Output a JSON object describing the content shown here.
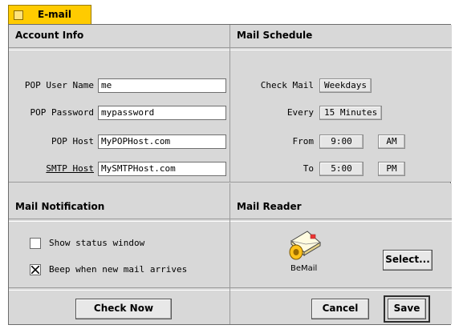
{
  "tab": {
    "title": "E-mail"
  },
  "account_info": {
    "title": "Account Info",
    "fields": [
      {
        "label": "POP User Name",
        "value": "me"
      },
      {
        "label": "POP Password",
        "value": "mypassword"
      },
      {
        "label": "POP Host",
        "value": "MyPOPHost.com"
      },
      {
        "label": "SMTP Host",
        "value": "MySMTPHost.com"
      }
    ]
  },
  "mail_schedule": {
    "title": "Mail Schedule",
    "check_mail_label": "Check Mail",
    "check_mail_value": "Weekdays",
    "every_label": "Every",
    "every_value": "15 Minutes",
    "from_label": "From",
    "from_time": "9:00",
    "from_period": "AM",
    "to_label": "To",
    "to_time": "5:00",
    "to_period": "PM"
  },
  "mail_notification": {
    "title": "Mail Notification",
    "show_status_label": "Show status window",
    "show_status_checked": false,
    "beep_label": "Beep when new mail arrives",
    "beep_checked": true,
    "check_now_label": "Check Now"
  },
  "mail_reader": {
    "title": "Mail Reader",
    "app_name": "BeMail",
    "select_label": "Select..."
  },
  "buttons": {
    "cancel": "Cancel",
    "save": "Save"
  },
  "colors": {
    "tab_yellow": "#ffcb00",
    "window_gray": "#d8d8d8"
  }
}
